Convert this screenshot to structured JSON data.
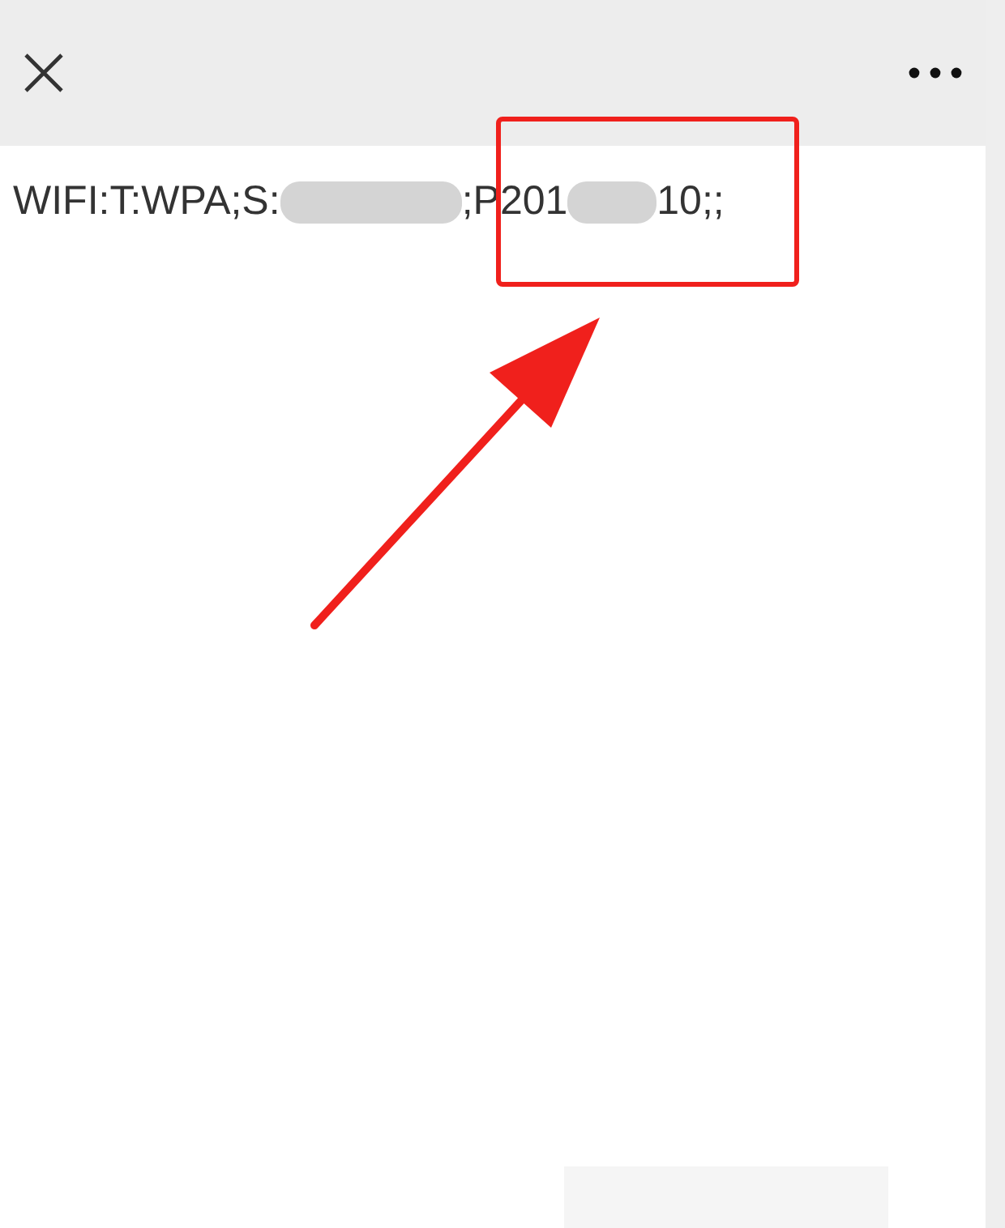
{
  "content": {
    "pieces": [
      {
        "kind": "text",
        "text": "WIFI:T:WPA;S:"
      },
      {
        "kind": "redacted"
      },
      {
        "kind": "text",
        "text": ";P"
      },
      {
        "kind": "text",
        "text": "201"
      },
      {
        "kind": "redacted"
      },
      {
        "kind": "text",
        "text": "10;;"
      }
    ]
  }
}
